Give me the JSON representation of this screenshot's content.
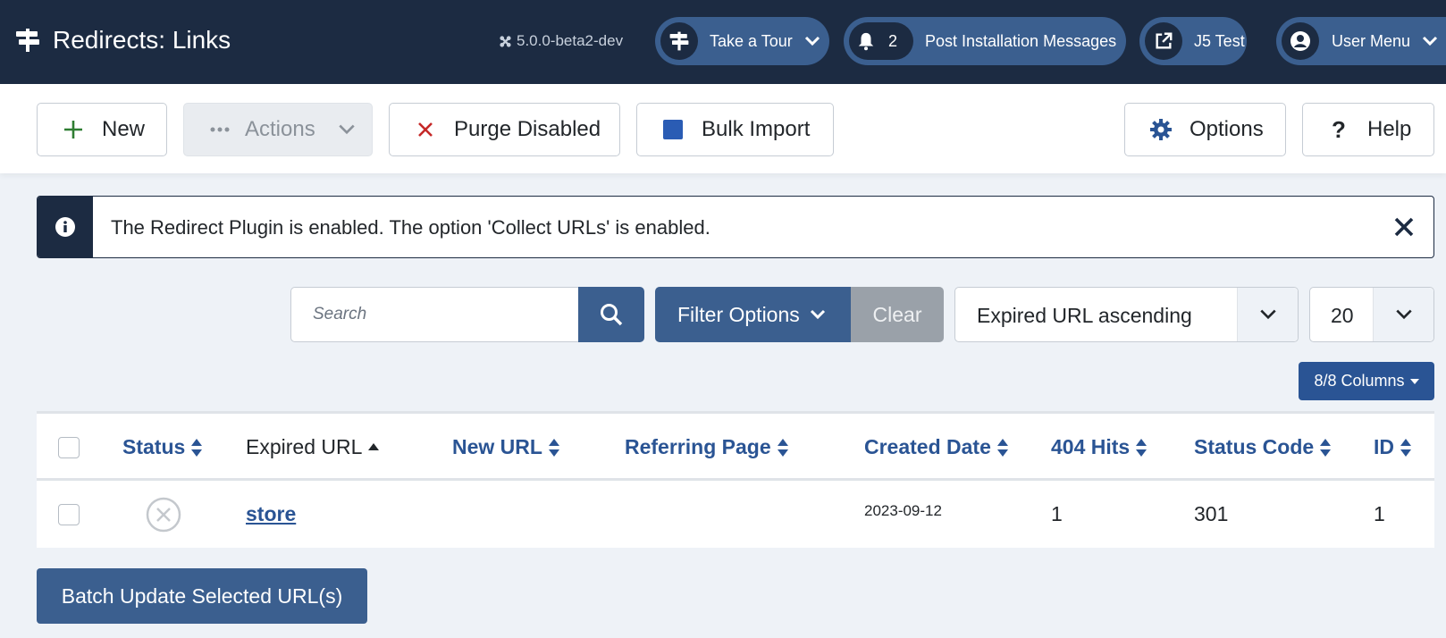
{
  "header": {
    "title": "Redirects: Links",
    "version": "5.0.0-beta2-dev",
    "tour_label": "Take a Tour",
    "messages_count": "2",
    "messages_label": "Post Installation Messages",
    "site_label": "J5 Test",
    "user_label": "User Menu"
  },
  "toolbar": {
    "new_label": "New",
    "actions_label": "Actions",
    "purge_label": "Purge Disabled",
    "bulk_label": "Bulk Import",
    "options_label": "Options",
    "help_label": "Help"
  },
  "alert": {
    "message": "The Redirect Plugin is enabled. The option 'Collect URLs' is enabled."
  },
  "filters": {
    "search_placeholder": "Search",
    "filter_options_label": "Filter Options",
    "clear_label": "Clear",
    "sort_value": "Expired URL ascending",
    "limit_value": "20",
    "columns_label": "8/8 Columns"
  },
  "table": {
    "headers": {
      "status": "Status",
      "expired_url": "Expired URL",
      "new_url": "New URL",
      "referring_page": "Referring Page",
      "created_date": "Created Date",
      "hits": "404 Hits",
      "status_code": "Status Code",
      "id": "ID"
    },
    "rows": [
      {
        "status": "unpublished",
        "expired_url": "store",
        "new_url": "",
        "referring_page": "",
        "created_date": "2023-09-12",
        "hits": "1",
        "status_code": "301",
        "id": "1"
      }
    ]
  },
  "batch": {
    "label": "Batch Update Selected URL(s)"
  },
  "colors": {
    "header_bg": "#1c2b42",
    "primary": "#3b5f8f",
    "link": "#2a5494",
    "danger": "#c52827",
    "success": "#2f7d32"
  }
}
